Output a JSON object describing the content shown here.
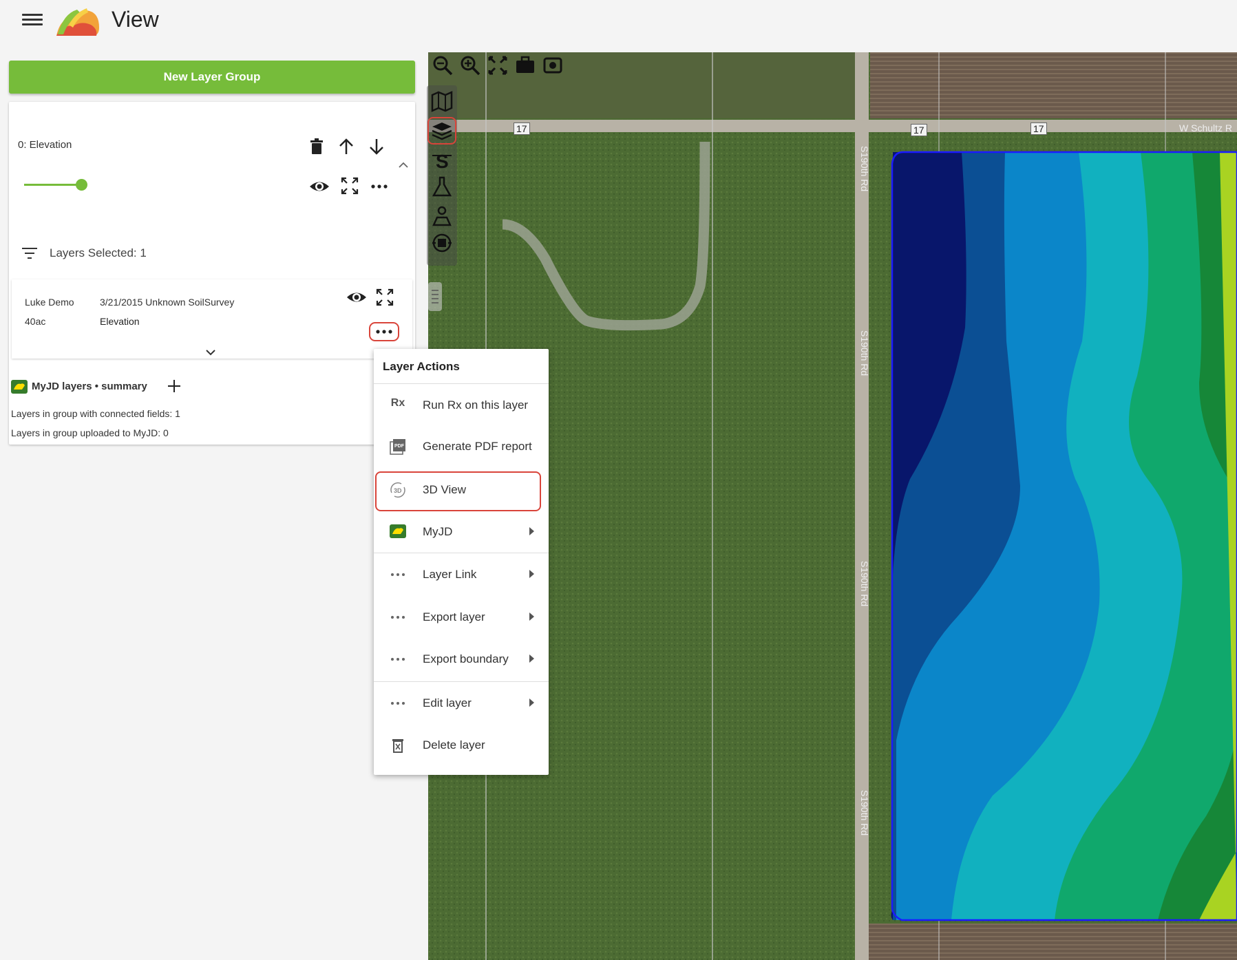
{
  "app": {
    "title": "View"
  },
  "left_panel": {
    "new_layer_group_label": "New Layer Group",
    "group": {
      "name": "0: Elevation",
      "opacity_value": 1.0,
      "layers_selected": "Layers Selected: 1"
    },
    "layer": {
      "owner": "Luke Demo",
      "acres": "40ac",
      "description": "3/21/2015 Unknown SoilSurvey",
      "type": "Elevation"
    },
    "myjd": {
      "summary_title": "MyJD layers • summary",
      "connected_fields": "Layers in group with connected fields: 1",
      "uploaded": "Layers in group uploaded to MyJD: 0"
    }
  },
  "map": {
    "road_labels": [
      "17",
      "17",
      "17",
      "W Schultz R"
    ],
    "vertical_road_labels": [
      "S190th Rd",
      "S190th Rd",
      "S190th Rd",
      "S190th Rd"
    ],
    "elevation_colors": [
      "#08166b",
      "#0b4f94",
      "#0b86c9",
      "#11b1bf",
      "#10a86c",
      "#168738",
      "#a9d322"
    ],
    "boundary_color": "#1a1aff",
    "toolbar_icons": [
      "zoom-out-icon",
      "zoom-in-icon",
      "fit-extent-icon",
      "camera-icon",
      "screenshot-icon"
    ],
    "side_tools": [
      "map-icon",
      "layers-icon",
      "s-tool-icon",
      "flask-icon",
      "marker-flask-icon",
      "scan-icon"
    ]
  },
  "context_menu": {
    "title": "Layer Actions",
    "items": [
      {
        "icon": "Rx",
        "label": "Run Rx on this layer",
        "submenu": false
      },
      {
        "icon": "pdf-icon",
        "label": "Generate PDF report",
        "submenu": false
      },
      {
        "icon": "3d-icon",
        "label": "3D View",
        "submenu": false
      },
      {
        "icon": "john-deere-icon",
        "label": "MyJD",
        "submenu": true
      },
      {
        "icon": "more-icon",
        "label": "Layer Link",
        "submenu": true
      },
      {
        "icon": "more-icon",
        "label": "Export layer",
        "submenu": true
      },
      {
        "icon": "more-icon",
        "label": "Export boundary",
        "submenu": true
      },
      {
        "icon": "more-icon",
        "label": "Edit layer",
        "submenu": true
      },
      {
        "icon": "delete-icon",
        "label": "Delete layer",
        "submenu": false
      }
    ]
  }
}
